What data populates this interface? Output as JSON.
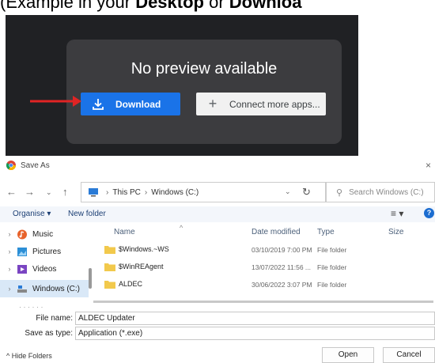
{
  "caption": {
    "prefix": "(Example in your ",
    "bold1": "Desktop",
    "middle": " or ",
    "bold2": "Downloa"
  },
  "preview": {
    "message": "No preview available",
    "download_label": "Download",
    "connect_label": "Connect more apps...",
    "accent": "#1a73e8",
    "arrow_color": "#e02424"
  },
  "dialog": {
    "title": "Save As",
    "address": {
      "segments": [
        "This PC",
        "Windows (C:)"
      ]
    },
    "search_placeholder": "Search Windows (C:)",
    "organise_label": "Organise ▾",
    "new_folder_label": "New folder",
    "sidebar": [
      {
        "label": "Music",
        "icon": "music-icon"
      },
      {
        "label": "Pictures",
        "icon": "pictures-icon"
      },
      {
        "label": "Videos",
        "icon": "videos-icon"
      },
      {
        "label": "Windows (C:)",
        "icon": "drive-icon",
        "selected": true
      }
    ],
    "columns": {
      "name": "Name",
      "date": "Date modified",
      "type": "Type",
      "size": "Size"
    },
    "files": [
      {
        "name": "$Windows.~WS",
        "date": "03/10/2019 7:00 PM",
        "type": "File folder"
      },
      {
        "name": "$WinREAgent",
        "date": "13/07/2022 11:56 ...",
        "type": "File folder"
      },
      {
        "name": "ALDEC",
        "date": "30/06/2022 3:07 PM",
        "type": "File folder"
      }
    ],
    "file_name_label": "File name:",
    "file_name_value": "ALDEC Updater",
    "save_type_label": "Save as type:",
    "save_type_value": "Application (*.exe)",
    "hide_folders_label": "Hide Folders",
    "open_label": "Open",
    "cancel_label": "Cancel"
  }
}
